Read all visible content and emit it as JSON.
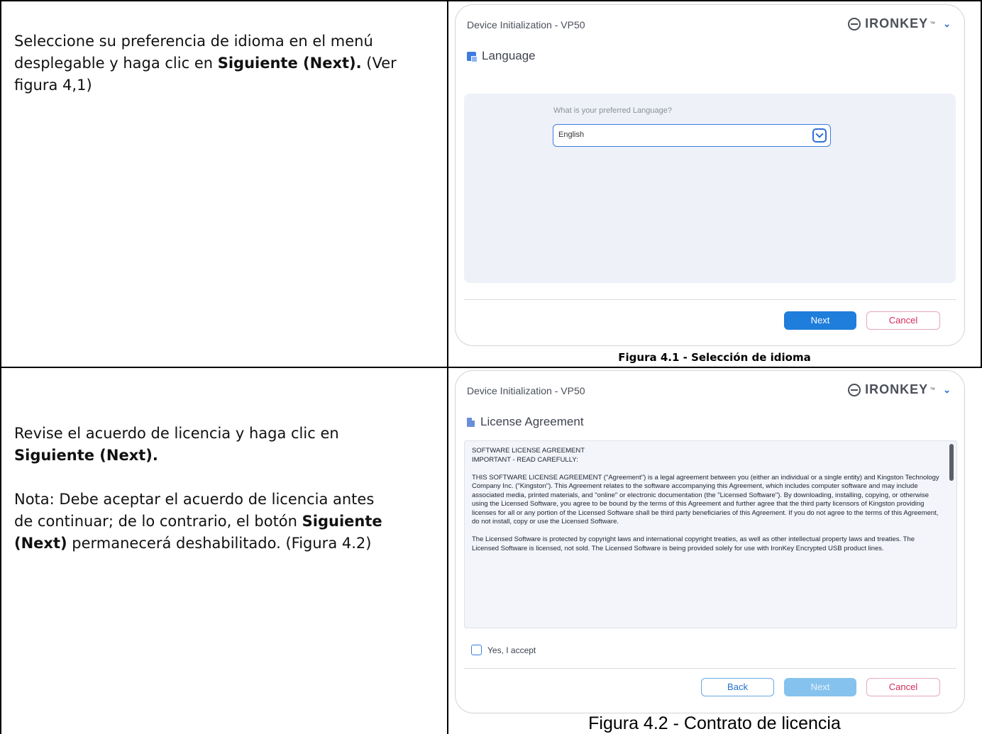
{
  "row1": {
    "instruction": {
      "line1": "Seleccione su preferencia de idioma en el menú",
      "line2_prefix": "desplegable y haga clic en ",
      "line2_bold": "Siguiente (Next).",
      "line2_suffix": " (Ver",
      "line3": "figura 4,1)"
    },
    "window": {
      "title": "Device Initialization - VP50",
      "brand": "IRONKEY",
      "brand_tm": "™",
      "section_title": "Language",
      "question": "What is your preferred Language?",
      "selected_language": "English",
      "next_button": "Next",
      "cancel_button": "Cancel"
    },
    "caption": "Figura 4.1 - Selección de idioma"
  },
  "row2": {
    "instruction": {
      "line1": "Revise el acuerdo de licencia y haga clic en",
      "line2_bold": "Siguiente (Next).",
      "note_line1": "Nota: Debe aceptar el acuerdo de licencia antes",
      "note_line2_prefix": "de continuar; de lo contrario, el botón ",
      "note_line2_bold": "Siguiente",
      "note_line3_bold": "(Next)",
      "note_line3_suffix": " permanecerá deshabilitado. (Figura 4.2)"
    },
    "window": {
      "title": "Device Initialization - VP50",
      "brand": "IRONKEY",
      "brand_tm": "™",
      "section_title": "License Agreement",
      "license_heading1": "SOFTWARE LICENSE AGREEMENT",
      "license_heading2": "IMPORTANT - READ CAREFULLY:",
      "license_para1": "THIS SOFTWARE LICENSE AGREEMENT (\"Agreement\") is a legal agreement between you (either an individual or a single entity) and Kingston Technology Company Inc. (\"Kingston\"). This Agreement relates to the software accompanying this Agreement, which includes computer software and may include associated media, printed materials, and \"online\" or electronic documentation (the \"Licensed Software\"). By downloading, installing, copying, or otherwise using the Licensed Software, you agree to be bound by the terms of this Agreement and further agree that the third party licensors of Kingston providing licenses for all or any portion of the Licensed Software shall be third party beneficiaries of this Agreement. If you do not agree to the terms of this Agreement, do not install, copy or use the Licensed Software.",
      "license_para2": "The Licensed Software is protected by copyright laws and international copyright treaties, as well as other intellectual property laws and treaties. The Licensed Software is licensed, not sold. The Licensed Software is being provided solely for use with IronKey Encrypted USB product lines.",
      "accept_label": "Yes, I accept",
      "back_button": "Back",
      "next_button": "Next",
      "cancel_button": "Cancel"
    },
    "caption": "Figura 4.2 - Contrato de licencia"
  },
  "colors": {
    "accent_blue": "#1f7ddb",
    "cancel_red": "#d22b5c",
    "panel_bg": "#eef1f8"
  }
}
